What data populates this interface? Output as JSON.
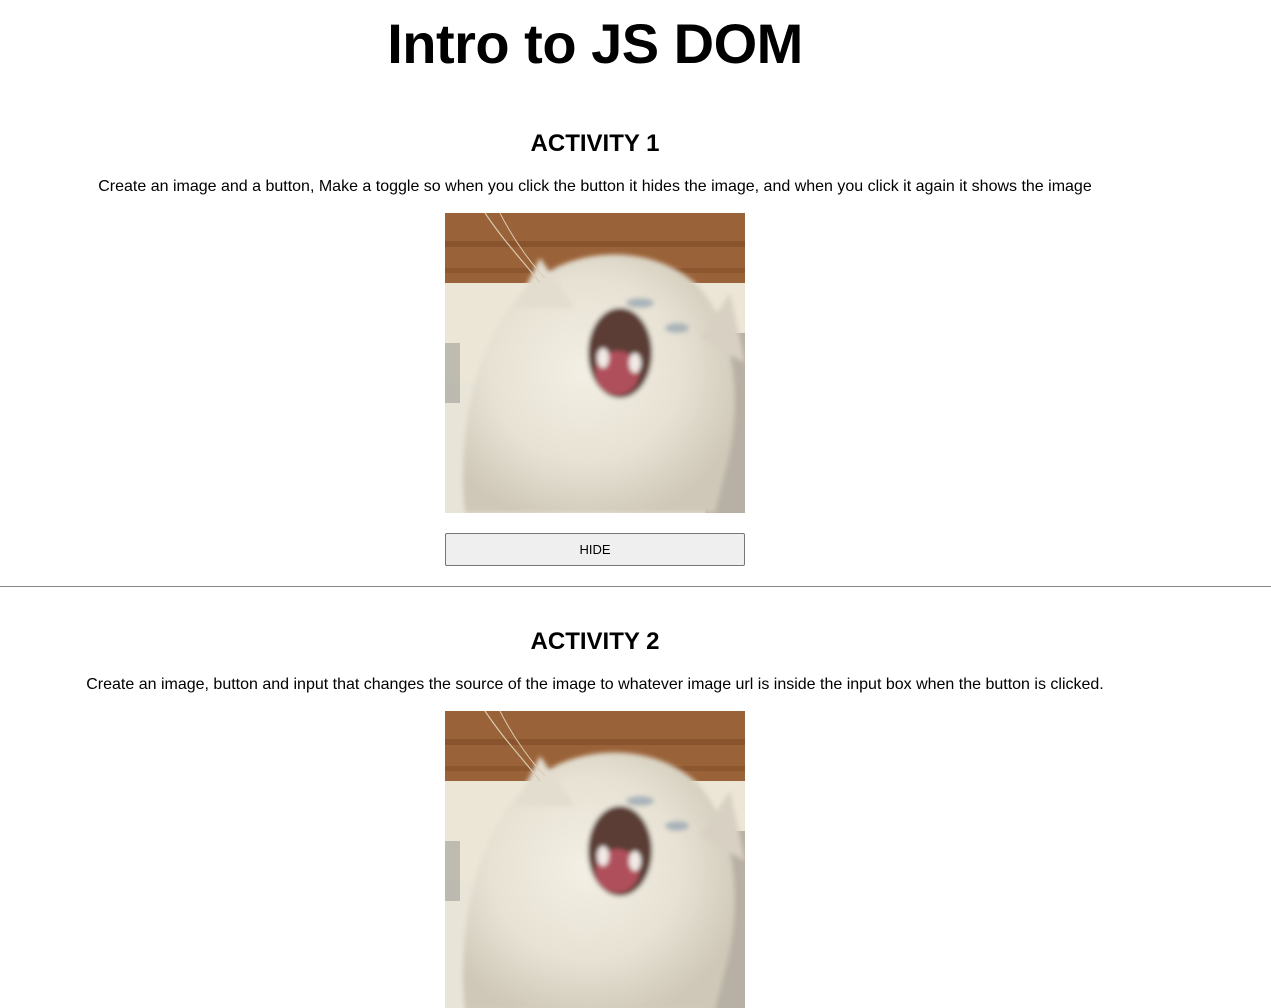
{
  "page": {
    "title": "Intro to JS DOM"
  },
  "activity1": {
    "title": "ACTIVITY 1",
    "description": "Create an image and a button, Make a toggle so when you click the button it hides the image, and when you click it again it shows the image",
    "image_alt": "cat photo",
    "button_label": "HIDE"
  },
  "activity2": {
    "title": "ACTIVITY 2",
    "description": "Create an image, button and input that changes the source of the image to whatever image url is inside the input box when the button is clicked.",
    "image_alt": "cat photo"
  },
  "colors": {
    "background": "#ffffff",
    "text": "#000000",
    "button_bg": "#efefef",
    "button_border": "#767676",
    "divider": "#888888"
  }
}
